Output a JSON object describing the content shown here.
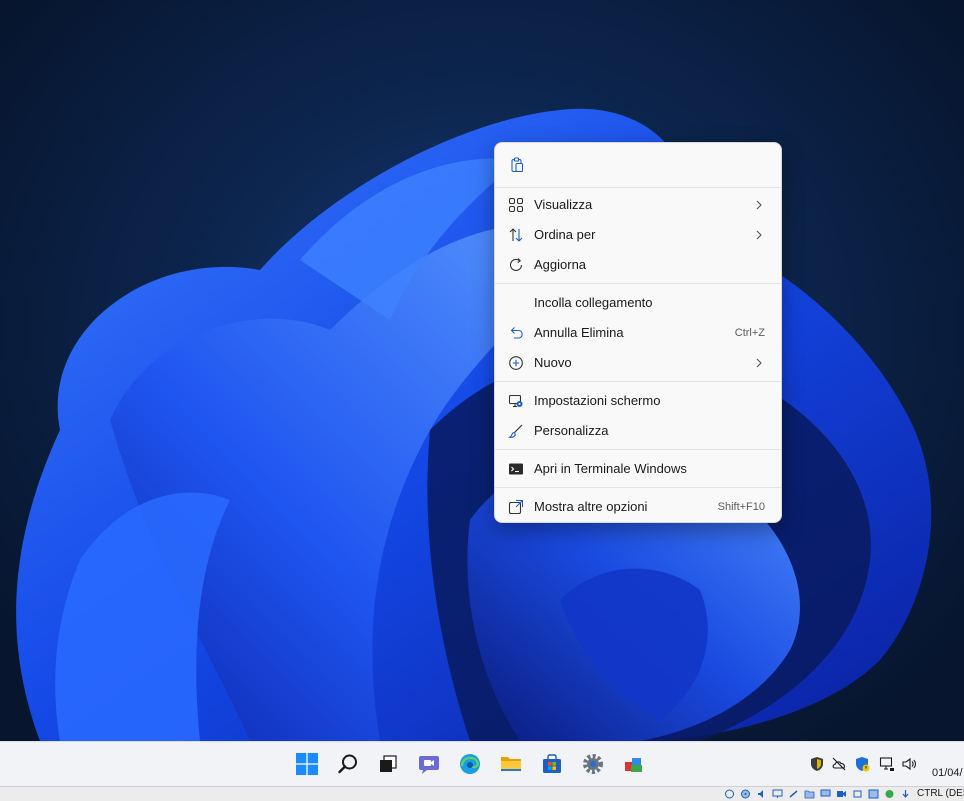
{
  "menu": {
    "paste_icon": "clipboard-paste-icon",
    "items": [
      {
        "label": "Visualizza",
        "icon": "grid-view-icon",
        "submenu": true,
        "shortcut": ""
      },
      {
        "label": "Ordina per",
        "icon": "sort-arrows-icon",
        "submenu": true,
        "shortcut": ""
      },
      {
        "label": "Aggiorna",
        "icon": "refresh-icon",
        "submenu": false,
        "shortcut": ""
      },
      {
        "label": "Incolla collegamento",
        "icon": "",
        "submenu": false,
        "shortcut": ""
      },
      {
        "label": "Annulla Elimina",
        "icon": "undo-icon",
        "submenu": false,
        "shortcut": "Ctrl+Z"
      },
      {
        "label": "Nuovo",
        "icon": "plus-circle-icon",
        "submenu": true,
        "shortcut": ""
      },
      {
        "label": "Impostazioni schermo",
        "icon": "display-settings-icon",
        "submenu": false,
        "shortcut": ""
      },
      {
        "label": "Personalizza",
        "icon": "brush-icon",
        "submenu": false,
        "shortcut": ""
      },
      {
        "label": "Apri in Terminale Windows",
        "icon": "terminal-icon",
        "submenu": false,
        "shortcut": ""
      },
      {
        "label": "Mostra altre opzioni",
        "icon": "more-options-icon",
        "submenu": false,
        "shortcut": "Shift+F10"
      }
    ]
  },
  "taskbar": {
    "apps": [
      "windows-start-icon",
      "search-icon",
      "task-view-icon",
      "teams-chat-icon",
      "edge-icon",
      "file-explorer-icon",
      "microsoft-store-icon",
      "settings-gear-icon",
      "virtualbox-icon"
    ],
    "tray": [
      "security-shield-icon",
      "onedrive-offline-icon",
      "defender-warning-icon",
      "network-icon",
      "volume-icon"
    ],
    "clock": "01/04/"
  },
  "vmbar": {
    "hostkey": "CTRL (DES"
  },
  "colors": {
    "accent": "#0067c0",
    "menu_bg": "#f9f9f9",
    "taskbar_bg": "#f1f3f6"
  }
}
